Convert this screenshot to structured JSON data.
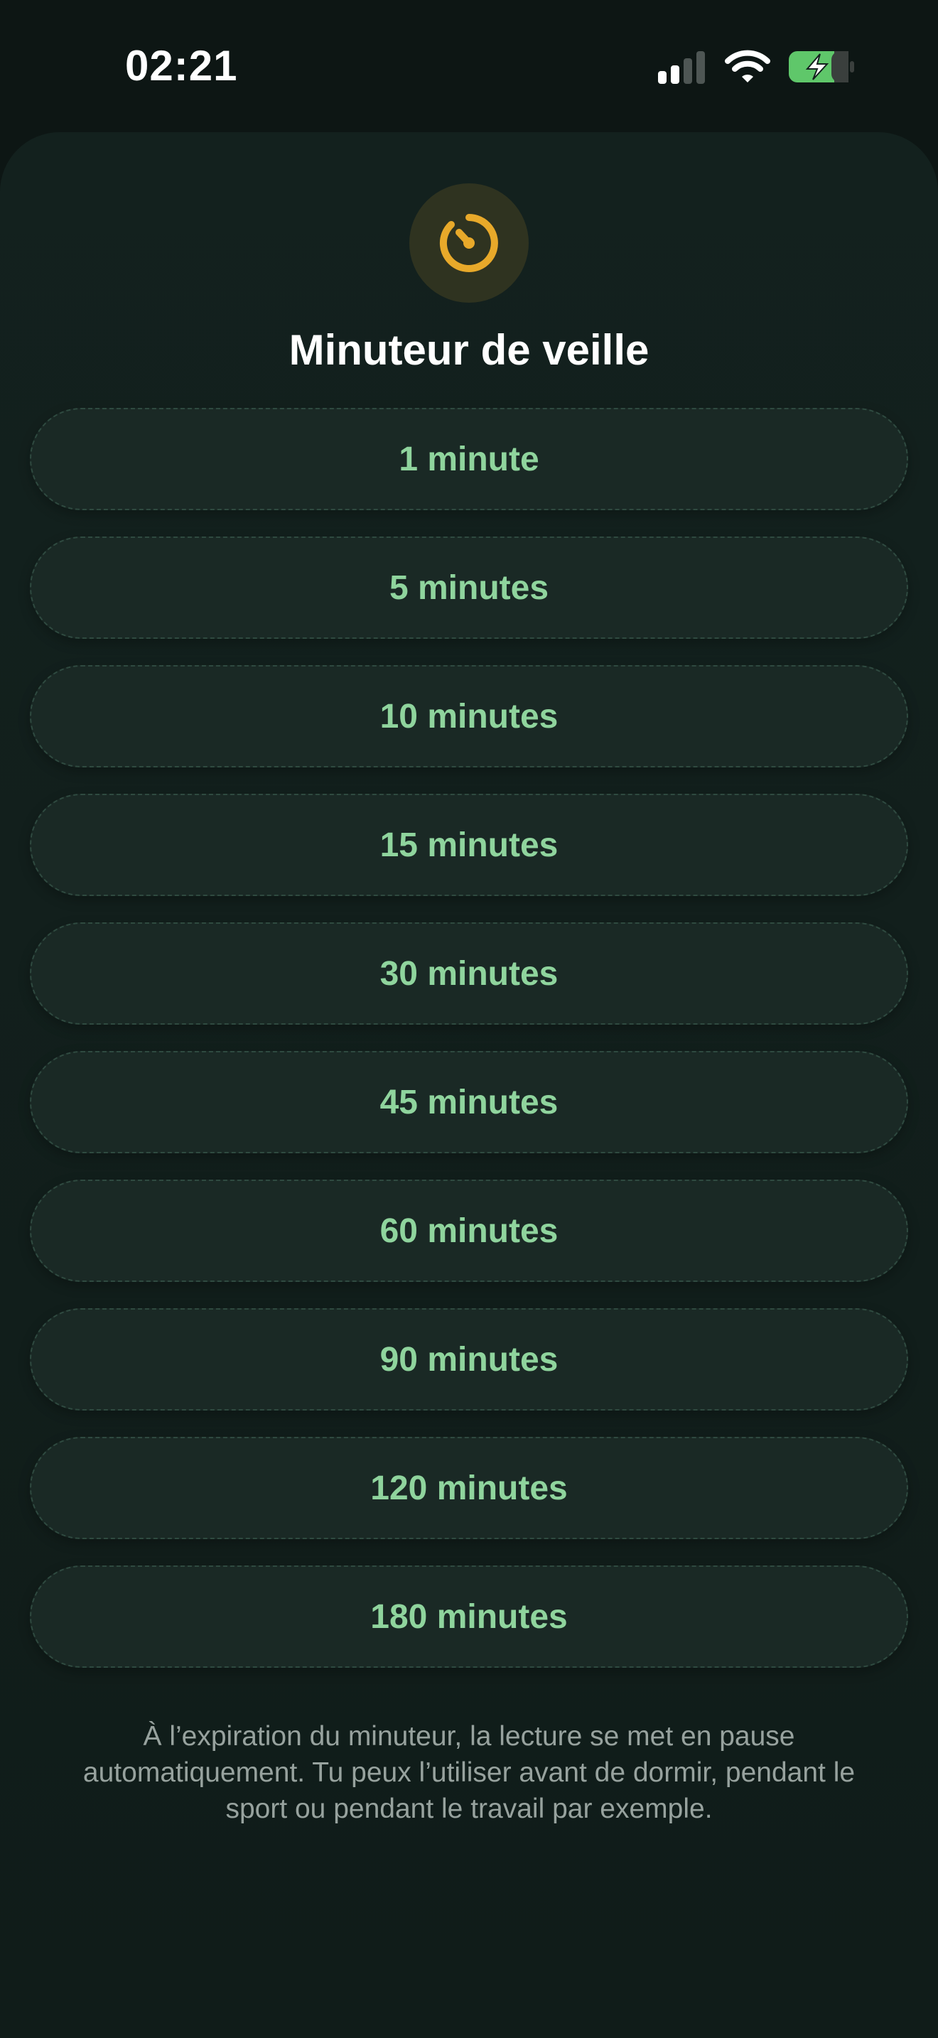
{
  "status_bar": {
    "time": "02:21",
    "signal_icon": "cellular-signal-icon",
    "wifi_icon": "wifi-icon",
    "battery_icon": "battery-charging-icon"
  },
  "sheet": {
    "icon": "timer-icon",
    "title": "Minuteur de veille",
    "options": [
      "1 minute",
      "5 minutes",
      "10 minutes",
      "15 minutes",
      "30 minutes",
      "45 minutes",
      "60 minutes",
      "90 minutes",
      "120 minutes",
      "180 minutes"
    ],
    "footer": "À l’expiration du minuteur, la lecture se met en pause automatiquement. Tu peux l’utiliser avant de dormir, pendant le sport ou pendant le travail par exemple."
  },
  "colors": {
    "background": "#0d1614",
    "accent_green": "#8fd49d",
    "timer_yellow": "#e8a92a",
    "battery_green": "#5fc76a"
  }
}
